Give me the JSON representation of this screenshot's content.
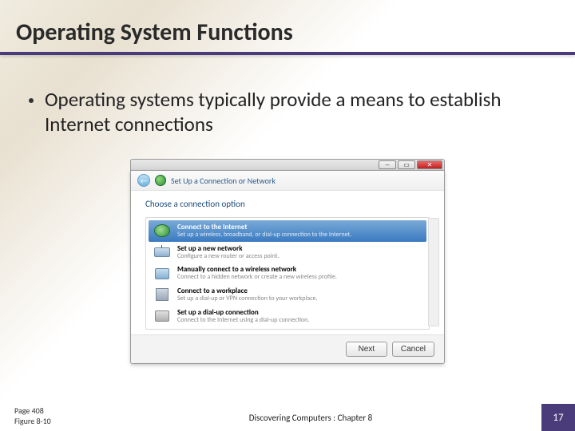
{
  "slide": {
    "title": "Operating System Functions",
    "bullet": "Operating systems typically provide a means to establish Internet connections"
  },
  "dialog": {
    "window_title": "Set Up a Connection or Network",
    "header_prompt": "Choose a connection option",
    "options": [
      {
        "title": "Connect to the Internet",
        "desc": "Set up a wireless, broadband, or dial-up connection to the Internet."
      },
      {
        "title": "Set up a new network",
        "desc": "Configure a new router or access point."
      },
      {
        "title": "Manually connect to a wireless network",
        "desc": "Connect to a hidden network or create a new wireless profile."
      },
      {
        "title": "Connect to a workplace",
        "desc": "Set up a dial-up or VPN connection to your workplace."
      },
      {
        "title": "Set up a dial-up connection",
        "desc": "Connect to the Internet using a dial-up connection."
      }
    ],
    "buttons": {
      "next": "Next",
      "cancel": "Cancel"
    }
  },
  "footer": {
    "page_ref": "Page 408",
    "figure_ref": "Figure 8-10",
    "center": "Discovering Computers : Chapter 8",
    "slide_num": "17"
  }
}
